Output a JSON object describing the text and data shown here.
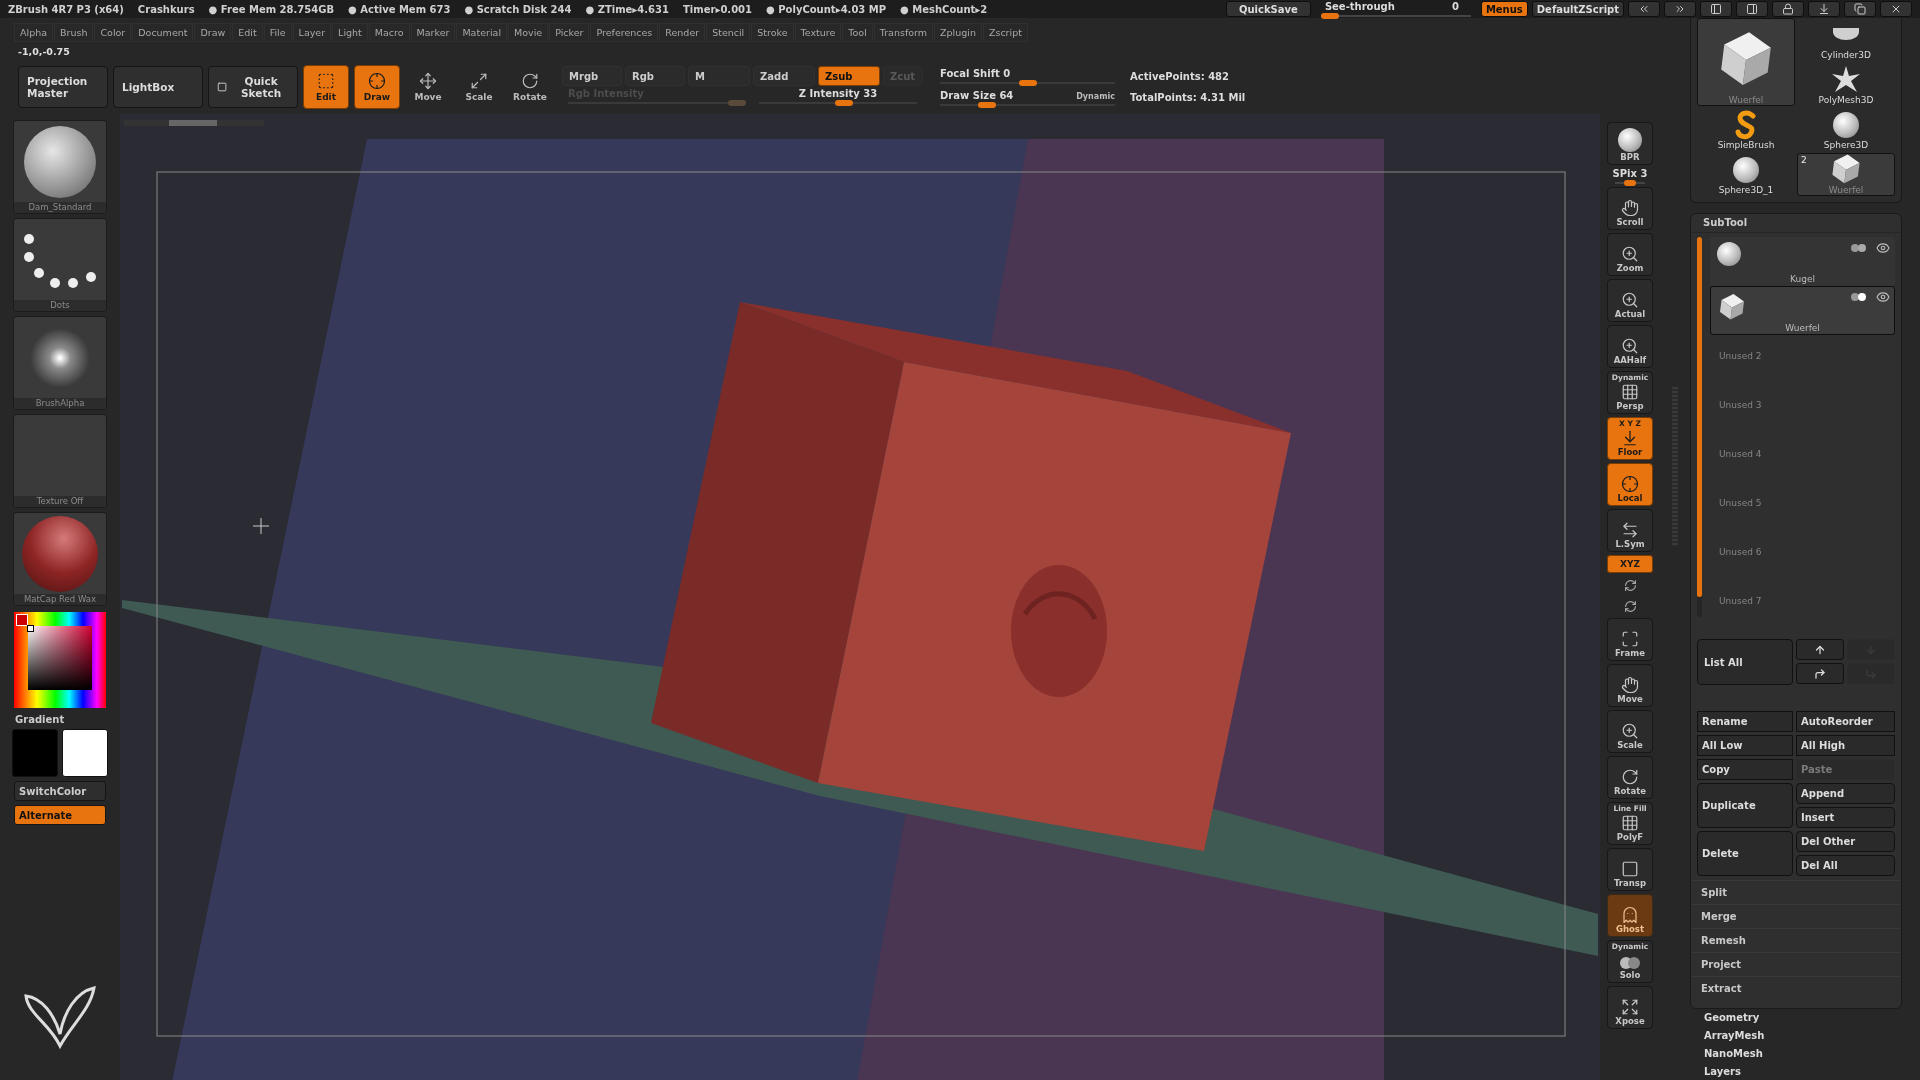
{
  "title_bar": {
    "app": "ZBrush 4R7 P3 (x64)",
    "document": "Crashkurs",
    "stats": [
      "● Free Mem 28.754GB",
      "● Active Mem 673",
      "● Scratch Disk 244",
      "● ZTime▸4.631",
      "Timer▸0.001",
      "● PolyCount▸4.03 MP",
      "● MeshCount▸2"
    ],
    "quicksave": "QuickSave",
    "see_through": {
      "label": "See-through",
      "value": "0",
      "level": 0.05
    },
    "menus": {
      "label": "Menus",
      "on": true
    },
    "script": "DefaultZScript"
  },
  "menu_bar": [
    "Alpha",
    "Brush",
    "Color",
    "Document",
    "Draw",
    "Edit",
    "File",
    "Layer",
    "Light",
    "Macro",
    "Marker",
    "Material",
    "Movie",
    "Picker",
    "Preferences",
    "Render",
    "Stencil",
    "Stroke",
    "Texture",
    "Tool",
    "Transform",
    "Zplugin",
    "Zscript"
  ],
  "coordinates": "-1,0,-0.75",
  "toolbar": {
    "projection_master": "Projection Master",
    "lightbox": "LightBox",
    "quick_sketch": "Quick Sketch",
    "modes": [
      {
        "label": "Edit",
        "kind": "edit",
        "selected": true
      },
      {
        "label": "Draw",
        "kind": "draw",
        "selected": true
      },
      {
        "label": "Move",
        "kind": "move",
        "selected": false
      },
      {
        "label": "Scale",
        "kind": "scale",
        "selected": false
      },
      {
        "label": "Rotate",
        "kind": "rotate",
        "selected": false
      }
    ],
    "channels": [
      {
        "label": "Mrgb",
        "selected": false,
        "disabled": false
      },
      {
        "label": "Rgb",
        "selected": false,
        "disabled": false
      },
      {
        "label": "M",
        "selected": false,
        "disabled": false
      },
      {
        "label": "Zadd",
        "selected": false,
        "disabled": false
      },
      {
        "label": "Zsub",
        "selected": true,
        "disabled": false
      },
      {
        "label": "Zcut",
        "selected": false,
        "disabled": true
      }
    ],
    "sliders": [
      {
        "label": "Rgb Intensity",
        "disabled": true,
        "level": 0.96
      },
      {
        "label": "Z Intensity 33",
        "disabled": false,
        "level": 0.54
      }
    ],
    "focal_shift": {
      "label": "Focal Shift 0",
      "level": 0.5
    },
    "draw_size": {
      "label": "Draw Size 64",
      "level": 0.27,
      "mode": "Dynamic"
    },
    "active_points": "ActivePoints: 482",
    "total_points": "TotalPoints: 4.31 Mil"
  },
  "left_shelf": {
    "thumbnails": [
      {
        "label": "Dam_Standard",
        "kind": "brush"
      },
      {
        "label": "Dots",
        "kind": "stroke"
      },
      {
        "label": "BrushAlpha",
        "kind": "alpha"
      },
      {
        "label": "Texture Off",
        "kind": "texture"
      },
      {
        "label": "MatCap Red Wax",
        "kind": "material"
      }
    ],
    "gradient": "Gradient",
    "swatches": [
      {
        "color": "#000000"
      },
      {
        "color": "#ffffff"
      }
    ],
    "switch_color": "SwitchColor",
    "alternate": {
      "label": "Alternate",
      "on": true
    }
  },
  "right_toolbar": [
    {
      "label": "BPR",
      "kind": "sphere",
      "on": false,
      "disabled": false
    },
    {
      "label": "SPix 3",
      "kind": "slider",
      "level": 0.5
    },
    {
      "label": "Scroll",
      "kind": "hand",
      "on": false,
      "disabled": false
    },
    {
      "label": "Zoom",
      "kind": "magnifier",
      "on": false,
      "disabled": false
    },
    {
      "label": "Actual",
      "kind": "magnifier",
      "on": false,
      "disabled": false
    },
    {
      "label": "AAHalf",
      "kind": "magnifier",
      "on": false,
      "disabled": false
    },
    {
      "label": "Persp",
      "caption": "Dynamic",
      "kind": "grid",
      "on": false,
      "disabled": false
    },
    {
      "label": "Floor",
      "caption": "X Y Z",
      "kind": "floor",
      "on": true,
      "disabled": false
    },
    {
      "label": "Local",
      "kind": "target",
      "on": true,
      "disabled": false
    },
    {
      "label": "L.Sym",
      "kind": "arrows",
      "on": false,
      "disabled": false
    },
    {
      "label": "XYZ",
      "kind": "axis",
      "on": true,
      "disabled": false
    },
    {
      "kind": "spin",
      "on": false,
      "disabled": false
    },
    {
      "kind": "spin",
      "on": false,
      "disabled": false
    },
    {
      "label": "Frame",
      "kind": "frame",
      "on": false,
      "disabled": false
    },
    {
      "label": "Move",
      "kind": "hand",
      "on": false,
      "disabled": false
    },
    {
      "label": "Scale",
      "kind": "magnifier",
      "on": false,
      "disabled": false
    },
    {
      "label": "Rotate",
      "kind": "rotate",
      "on": false,
      "disabled": false
    },
    {
      "label": "PolyF",
      "caption": "Line Fill",
      "kind": "grid",
      "on": false,
      "disabled": false
    },
    {
      "label": "Transp",
      "kind": "square",
      "on": false,
      "disabled": false
    },
    {
      "label": "Ghost",
      "kind": "ghost",
      "on": true,
      "disabled": true
    },
    {
      "label": "Solo",
      "caption": "Dynamic",
      "kind": "circles",
      "on": false,
      "disabled": false
    },
    {
      "label": "Xpose",
      "kind": "expand",
      "on": false,
      "disabled": false
    }
  ],
  "tool_palette": {
    "tools": [
      {
        "label": "Wuerfel",
        "kind": "cube",
        "selected": true
      },
      {
        "label": "Cylinder3D",
        "kind": "cylinder",
        "selected": false
      },
      {
        "label": "PolyMesh3D",
        "kind": "star",
        "selected": false
      },
      {
        "label": "SimpleBrush",
        "kind": "swirl",
        "selected": false
      },
      {
        "label": "Sphere3D",
        "kind": "sphere",
        "selected": false
      },
      {
        "label": "Sphere3D_1",
        "kind": "sphere",
        "selected": false
      },
      {
        "label": "Wuerfel",
        "kind": "cube",
        "badge": "2",
        "selected": true
      }
    ]
  },
  "subtool": {
    "title": "SubTool",
    "items": [
      {
        "name": "Kugel",
        "kind": "sphere",
        "selected": false
      },
      {
        "name": "Wuerfel",
        "kind": "cube",
        "selected": true
      },
      {
        "name": "Unused 2",
        "kind": "empty",
        "selected": false
      },
      {
        "name": "Unused 3",
        "kind": "empty",
        "selected": false
      },
      {
        "name": "Unused 4",
        "kind": "empty",
        "selected": false
      },
      {
        "name": "Unused 5",
        "kind": "empty",
        "selected": false
      },
      {
        "name": "Unused 6",
        "kind": "empty",
        "selected": false
      },
      {
        "name": "Unused 7",
        "kind": "empty",
        "selected": false
      }
    ],
    "list_all": "List All",
    "arrows": [
      {
        "kind": "up",
        "disabled": false
      },
      {
        "kind": "down",
        "disabled": true
      },
      {
        "kind": "turn-up",
        "disabled": false
      },
      {
        "kind": "turn-down",
        "disabled": true
      }
    ],
    "actions": [
      {
        "label": "Rename",
        "kind": "short",
        "disabled": false
      },
      {
        "label": "AutoReorder",
        "kind": "short",
        "disabled": false
      },
      {
        "label": "All Low",
        "kind": "short",
        "disabled": false
      },
      {
        "label": "All High",
        "kind": "short",
        "disabled": false
      },
      {
        "label": "Copy",
        "kind": "short",
        "disabled": false
      },
      {
        "label": "Paste",
        "kind": "short",
        "disabled": true
      },
      {
        "label": "Append",
        "kind": "short",
        "disabled": false
      },
      {
        "label": "Duplicate",
        "kind": "tall",
        "disabled": false
      },
      {
        "label": "Insert",
        "kind": "short",
        "disabled": false
      },
      {
        "label": "Del Other",
        "kind": "short",
        "disabled": false
      },
      {
        "label": "Delete",
        "kind": "tall",
        "disabled": false
      },
      {
        "label": "Del All",
        "kind": "short",
        "disabled": false
      }
    ],
    "sections": [
      "Split",
      "Merge",
      "Remesh",
      "Project",
      "Extract"
    ]
  },
  "palettes": [
    "Geometry",
    "ArrayMesh",
    "NanoMesh",
    "Layers"
  ]
}
